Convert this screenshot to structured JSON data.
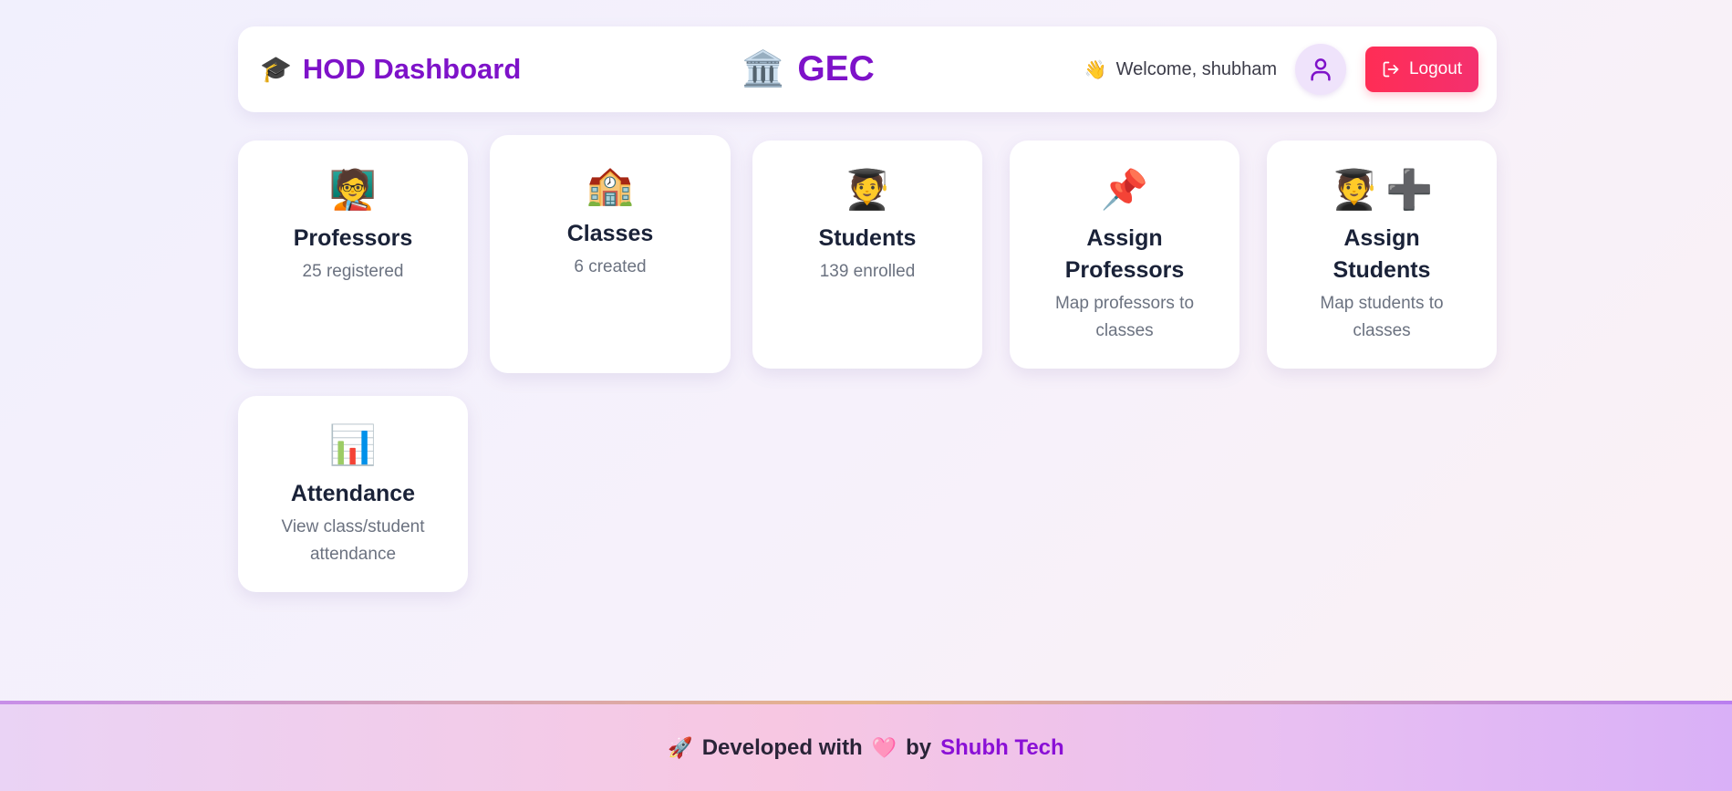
{
  "header": {
    "brand_icon": "🎓",
    "brand_title": "HOD Dashboard",
    "center_icon": "🏛️",
    "center_title": "GEC",
    "welcome_icon": "👋",
    "welcome_text": "Welcome, shubham",
    "avatar_icon": "user-icon",
    "logout_label": "Logout"
  },
  "cards": [
    {
      "icon": "🧑‍🏫",
      "title": "Professors",
      "subtitle": "25 registered"
    },
    {
      "icon": "🏫",
      "title": "Classes",
      "subtitle": "6 created"
    },
    {
      "icon": "🧑‍🎓",
      "title": "Students",
      "subtitle": "139 enrolled"
    },
    {
      "icon": "📌",
      "title": "Assign Professors",
      "subtitle": "Map professors to classes"
    },
    {
      "icon": "🧑‍🎓",
      "icon2": "➕",
      "title": "Assign Students",
      "subtitle": "Map students to classes"
    },
    {
      "icon": "📊",
      "title": "Attendance",
      "subtitle": "View class/student attendance"
    }
  ],
  "footer": {
    "rocket_icon": "🚀",
    "prefix": "Developed with",
    "heart_icon": "🩷",
    "by": "by",
    "brand": "Shubh Tech"
  },
  "colors": {
    "brand_purple": "#7e12c9",
    "logout_red": "#ff2d55",
    "footer_brand": "#8a10d6"
  }
}
